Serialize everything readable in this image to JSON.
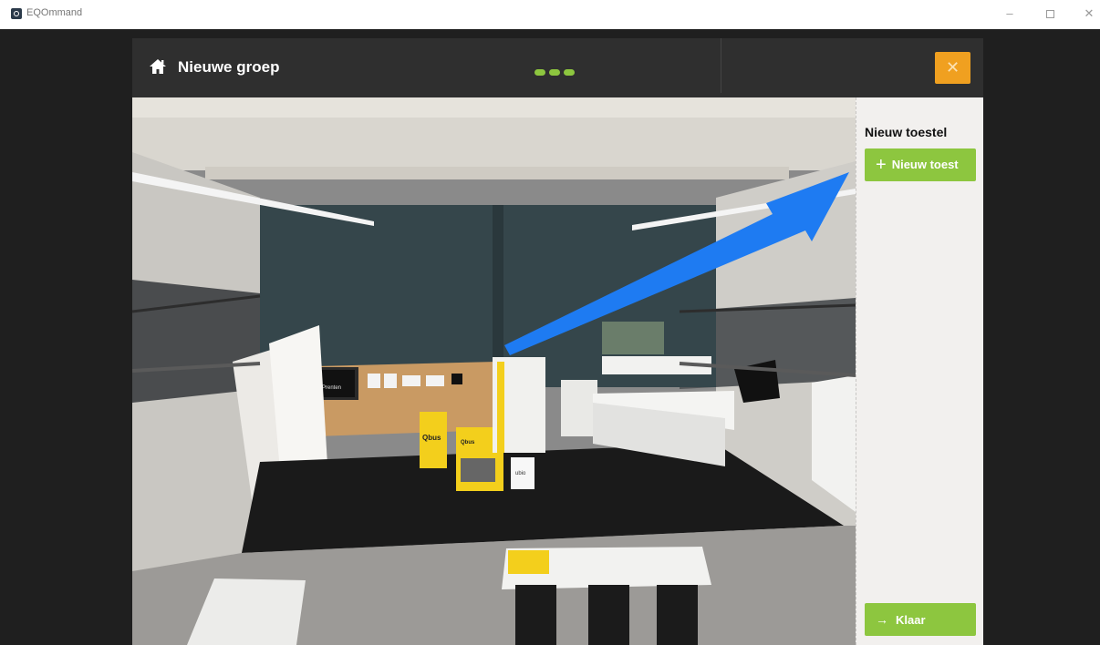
{
  "window": {
    "app_title": "EQOmmand",
    "min_label": "–",
    "close_label": "✕"
  },
  "dialog": {
    "title": "Nieuwe groep",
    "close_label": "✕",
    "progress_steps": 3
  },
  "photo": {
    "poster_title": "Prenten",
    "box_label_1": "Qbus",
    "box_label_2": "Qbus",
    "pedestal_label": "ubio",
    "annotation": "blue-arrow-pointing-to-new-device-button"
  },
  "side_panel": {
    "heading": "Nieuw toestel",
    "new_device_label": "Nieuw toest",
    "done_label": "Klaar"
  },
  "colors": {
    "accent_green": "#8dc63f",
    "close_orange": "#f0a020",
    "arrow_blue": "#1e7bf2",
    "header_bg": "#2f2f2f"
  }
}
